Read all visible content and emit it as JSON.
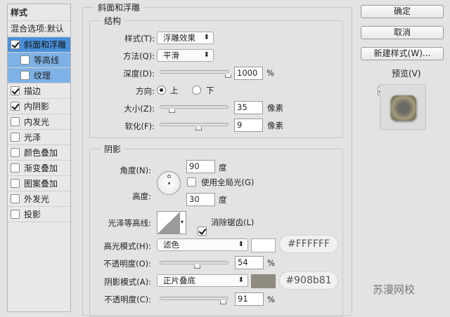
{
  "sidebar": {
    "title": "样式",
    "blend": "混合选项:默认",
    "items": [
      {
        "label": "斜面和浮雕",
        "checked": true
      },
      {
        "label": "等高线",
        "checked": false
      },
      {
        "label": "纹理",
        "checked": false
      },
      {
        "label": "描边",
        "checked": true
      },
      {
        "label": "内阴影",
        "checked": true
      },
      {
        "label": "内发光",
        "checked": false
      },
      {
        "label": "光泽",
        "checked": false
      },
      {
        "label": "颜色叠加",
        "checked": false
      },
      {
        "label": "渐变叠加",
        "checked": false
      },
      {
        "label": "图案叠加",
        "checked": false
      },
      {
        "label": "外发光",
        "checked": false
      },
      {
        "label": "投影",
        "checked": false
      }
    ]
  },
  "panel": {
    "title": "斜面和浮雕",
    "structure": {
      "title": "结构",
      "style_label": "样式(T):",
      "style_value": "浮雕效果",
      "method_label": "方法(Q):",
      "method_value": "平滑",
      "depth_label": "深度(D):",
      "depth_value": "1000",
      "depth_unit": "%",
      "direction_label": "方向:",
      "dir_up": "上",
      "dir_down": "下",
      "size_label": "大小(Z):",
      "size_value": "35",
      "size_unit": "像素",
      "soften_label": "软化(F):",
      "soften_value": "9",
      "soften_unit": "像素"
    },
    "shading": {
      "title": "阴影",
      "angle_label": "角度(N):",
      "angle_value": "90",
      "angle_unit": "度",
      "global_light": "使用全局光(G)",
      "altitude_label": "高度:",
      "altitude_value": "30",
      "altitude_unit": "度",
      "gloss_label": "光泽等高线:",
      "antialias": "消除锯齿(L)",
      "highlight_label": "高光模式(H):",
      "highlight_mode": "滤色",
      "highlight_color": "#FFFFFF",
      "highlight_hex": "#FFFFFF",
      "hl_opacity_label": "不透明度(O):",
      "hl_opacity": "54",
      "pct": "%",
      "shadow_label": "阴影模式(A):",
      "shadow_mode": "正片叠底",
      "shadow_color": "#908b81",
      "shadow_hex": "#908b81",
      "sh_opacity_label": "不透明度(C):",
      "sh_opacity": "91"
    }
  },
  "buttons": {
    "ok": "确定",
    "cancel": "取消",
    "new_style": "新建样式(W)...",
    "preview": "预览(V)"
  },
  "watermark": "苏漫网校"
}
